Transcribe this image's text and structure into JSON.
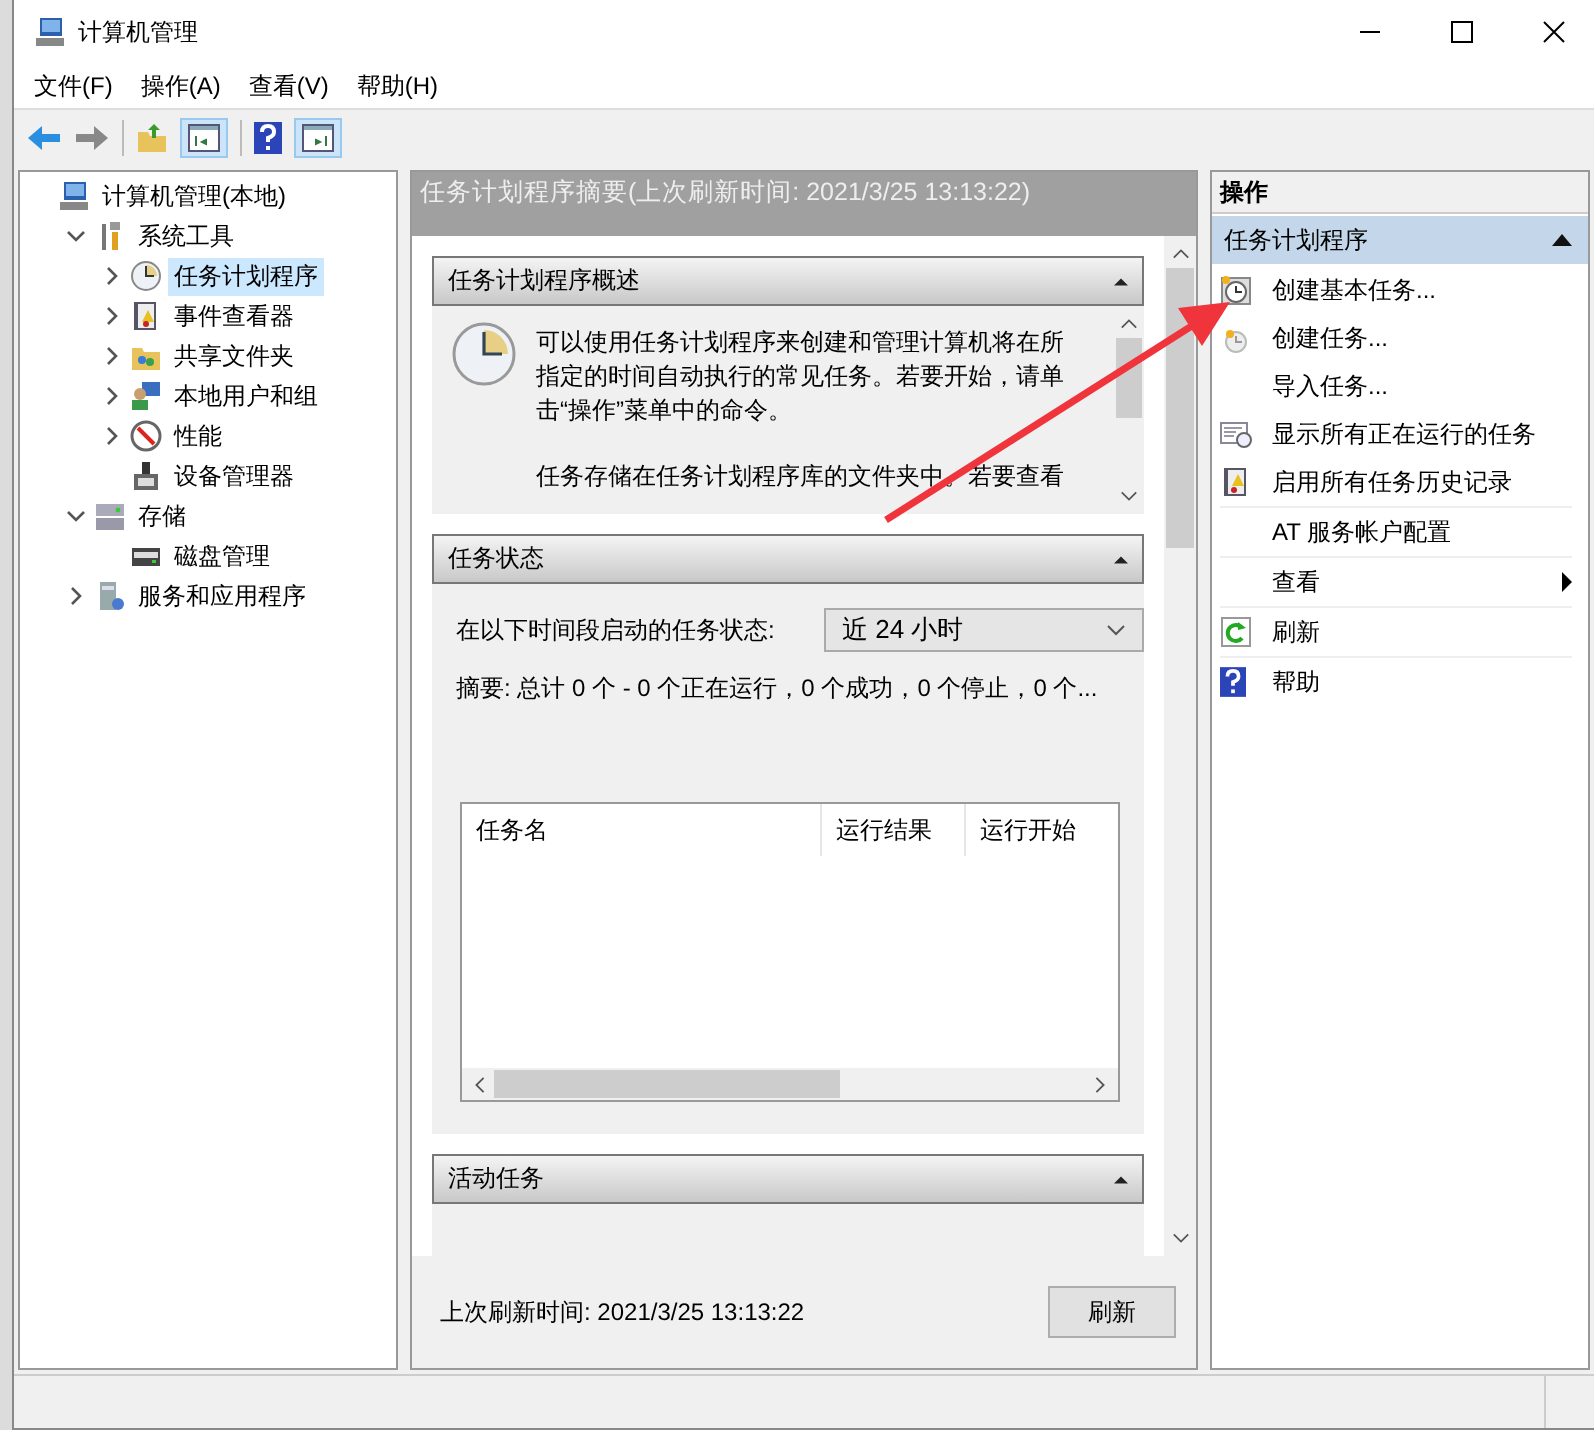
{
  "window": {
    "title": "计算机管理"
  },
  "menu": [
    "文件(F)",
    "操作(A)",
    "查看(V)",
    "帮助(H)"
  ],
  "tree": [
    {
      "label": "计算机管理(本地)",
      "selected": false,
      "children": [
        {
          "label": "系统工具",
          "expanded": true,
          "selected": false,
          "children": [
            {
              "label": "任务计划程序",
              "expanded": false,
              "selected": true
            },
            {
              "label": "事件查看器",
              "expanded": false,
              "selected": false
            },
            {
              "label": "共享文件夹",
              "expanded": false,
              "selected": false
            },
            {
              "label": "本地用户和组",
              "expanded": false,
              "selected": false
            },
            {
              "label": "性能",
              "expanded": false,
              "selected": false
            },
            {
              "label": "设备管理器",
              "selected": false
            }
          ]
        },
        {
          "label": "存储",
          "expanded": true,
          "selected": false,
          "children": [
            {
              "label": "磁盘管理",
              "selected": false
            }
          ]
        },
        {
          "label": "服务和应用程序",
          "expanded": false,
          "selected": false
        }
      ]
    }
  ],
  "summary": {
    "title": "任务计划程序摘要(上次刷新时间: 2021/3/25 13:13:22)",
    "overview": {
      "title": "任务计划程序概述",
      "paragraphs": [
        "可以使用任务计划程序来创建和管理计算机将在所指定的时间自动执行的常见任务。若要开始，请单击“操作”菜单中的命令。",
        "任务存储在任务计划程序库的文件夹中。若要查看"
      ]
    },
    "status": {
      "title": "任务状态",
      "period_label": "在以下时间段启动的任务状态:",
      "period_value": "近 24 小时",
      "summary_text": "摘要: 总计 0 个 - 0 个正在运行，0 个成功，0 个停止，0 个...",
      "columns": [
        "任务名",
        "运行结果",
        "运行开始"
      ]
    },
    "active": {
      "title": "活动任务"
    },
    "last_refresh": "上次刷新时间: 2021/3/25 13:13:22",
    "refresh_button": "刷新"
  },
  "actions": {
    "title": "操作",
    "group": "任务计划程序",
    "items": [
      {
        "label": "创建基本任务...",
        "kind": "item"
      },
      {
        "label": "创建任务...",
        "kind": "item"
      },
      {
        "label": "导入任务...",
        "kind": "item"
      },
      {
        "label": "显示所有正在运行的任务",
        "kind": "item"
      },
      {
        "label": "启用所有任务历史记录",
        "kind": "item"
      },
      {
        "label": "AT 服务帐户配置",
        "kind": "item"
      },
      {
        "label": "查看",
        "kind": "submenu"
      },
      {
        "label": "刷新",
        "kind": "item"
      },
      {
        "label": "帮助",
        "kind": "item"
      }
    ]
  }
}
